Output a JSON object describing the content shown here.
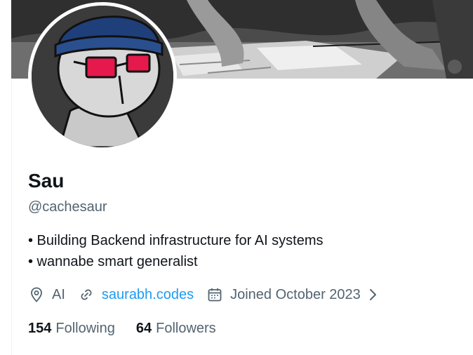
{
  "profile": {
    "name": "Sau",
    "handle": "@cachesaur",
    "bio": [
      "• Building Backend infrastructure for AI systems",
      "• wannabe smart generalist"
    ],
    "location": "AI",
    "website": "saurabh.codes",
    "joined": "Joined October 2023",
    "following_count": "154",
    "following_label": "Following",
    "followers_count": "64",
    "followers_label": "Followers"
  },
  "icons": {
    "location": "location-pin-icon",
    "website": "link-icon",
    "joined": "calendar-icon",
    "more": "chevron-right-icon"
  },
  "colors": {
    "text_primary": "#0f1419",
    "text_secondary": "#536471",
    "link": "#1d9bf0",
    "avatar_hat": "#1f3f7a",
    "avatar_glasses": "#e5194b"
  }
}
